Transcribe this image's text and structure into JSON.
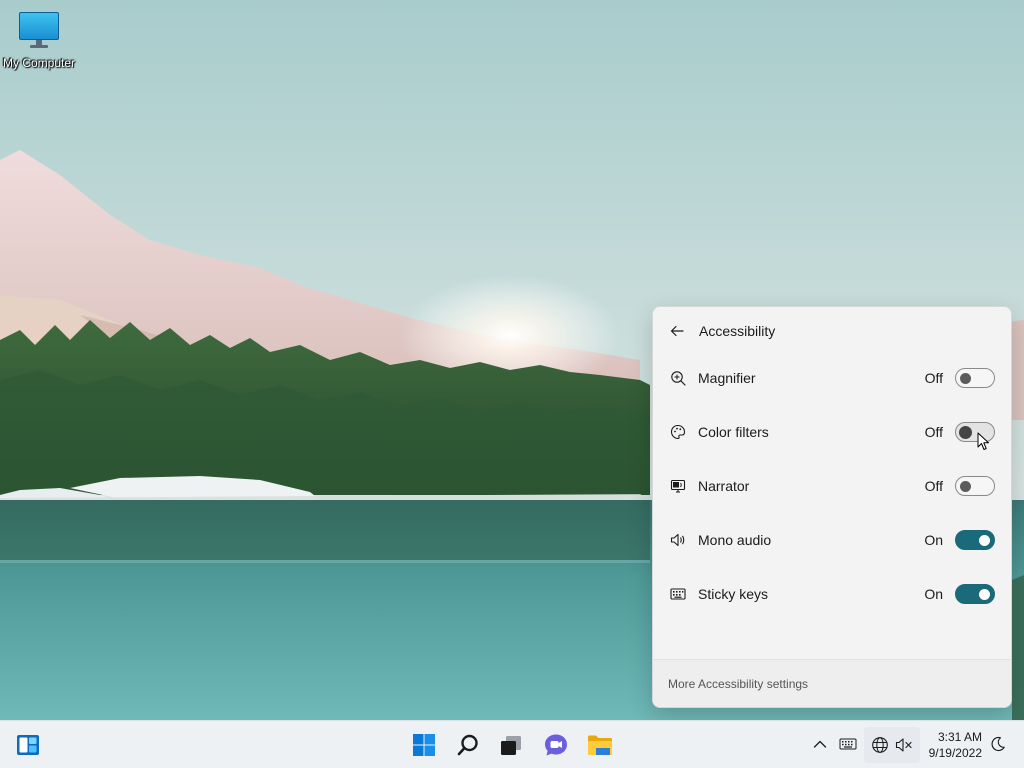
{
  "desktop": {
    "icons": [
      {
        "label": "My Computer"
      }
    ]
  },
  "accessibility_flyout": {
    "title": "Accessibility",
    "items": [
      {
        "name": "Magnifier",
        "state": "Off",
        "on": false,
        "icon": "magnifier-icon"
      },
      {
        "name": "Color filters",
        "state": "Off",
        "on": false,
        "icon": "color-filters-icon"
      },
      {
        "name": "Narrator",
        "state": "Off",
        "on": false,
        "icon": "narrator-icon"
      },
      {
        "name": "Mono audio",
        "state": "On",
        "on": true,
        "icon": "mono-audio-icon"
      },
      {
        "name": "Sticky keys",
        "state": "On",
        "on": true,
        "icon": "sticky-keys-icon"
      }
    ],
    "footer_link": "More Accessibility settings",
    "accent_color": "#1b6a7a"
  },
  "taskbar": {
    "apps": [
      "widgets-icon",
      "start-icon",
      "search-icon",
      "task-view-icon",
      "chat-icon",
      "file-explorer-icon"
    ],
    "tray": [
      "show-hidden-icons",
      "touch-keyboard-icon",
      "network-icon",
      "volume-muted-icon"
    ],
    "clock": {
      "time": "3:31 AM",
      "date": "9/19/2022"
    }
  }
}
